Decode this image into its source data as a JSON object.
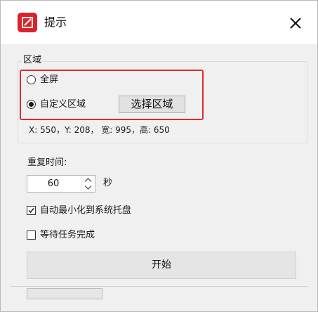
{
  "window": {
    "title": "提示"
  },
  "region": {
    "group_label": "区域",
    "options": [
      {
        "label": "全屏",
        "selected": false
      },
      {
        "label": "自定义区域",
        "selected": true
      }
    ],
    "select_button": "选择区域",
    "coords_text": "X: 550，Y: 208， 宽: 995，高: 650"
  },
  "repeat": {
    "label": "重复时间:",
    "value": "60",
    "unit": "秒"
  },
  "options": {
    "minimize": {
      "label": "自动最小化到系统托盘",
      "checked": true
    },
    "wait": {
      "label": "等待任务完成",
      "checked": false
    }
  },
  "start_button": "开始",
  "progress": {
    "value": 0
  },
  "colors": {
    "accent_red": "#d8232a",
    "highlight_border": "#e02b2b"
  }
}
